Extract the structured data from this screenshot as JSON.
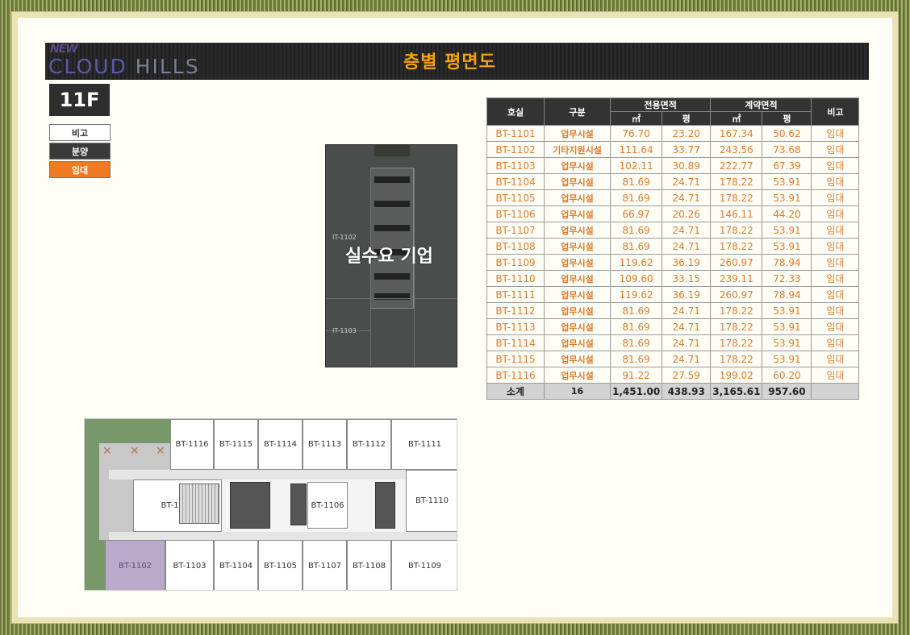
{
  "header": {
    "logo_new": "NEW",
    "logo_cloud": "CLOUD",
    "logo_hills": " HILLS",
    "title": "층별 평면도"
  },
  "floor": "11F",
  "legend": [
    {
      "label": "비고"
    },
    {
      "label": "분양"
    },
    {
      "label": "임대"
    }
  ],
  "small_plan": {
    "label_top": "IT-1102",
    "label_bottom": "IT-1103",
    "overlay": "실수요 기업"
  },
  "table": {
    "headers": {
      "unit": "호실",
      "type": "구분",
      "exclusive": "전용면적",
      "contract": "계약면적",
      "sqm1": "㎡",
      "py1": "평",
      "sqm2": "㎡",
      "py2": "평",
      "note": "비고"
    },
    "rows": [
      [
        "BT-1101",
        "업무시설",
        "76.70",
        "23.20",
        "167.34",
        "50.62",
        "임대"
      ],
      [
        "BT-1102",
        "기타지원시설",
        "111.64",
        "33.77",
        "243.56",
        "73.68",
        "임대"
      ],
      [
        "BT-1103",
        "업무시설",
        "102.11",
        "30.89",
        "222.77",
        "67.39",
        "임대"
      ],
      [
        "BT-1104",
        "업무시설",
        "81.69",
        "24.71",
        "178.22",
        "53.91",
        "임대"
      ],
      [
        "BT-1105",
        "업무시설",
        "81.69",
        "24.71",
        "178.22",
        "53.91",
        "임대"
      ],
      [
        "BT-1106",
        "업무시설",
        "66.97",
        "20.26",
        "146.11",
        "44.20",
        "임대"
      ],
      [
        "BT-1107",
        "업무시설",
        "81.69",
        "24.71",
        "178.22",
        "53.91",
        "임대"
      ],
      [
        "BT-1108",
        "업무시설",
        "81.69",
        "24.71",
        "178.22",
        "53.91",
        "임대"
      ],
      [
        "BT-1109",
        "업무시설",
        "119.62",
        "36.19",
        "260.97",
        "78.94",
        "임대"
      ],
      [
        "BT-1110",
        "업무시설",
        "109.60",
        "33.15",
        "239.11",
        "72.33",
        "임대"
      ],
      [
        "BT-1111",
        "업무시설",
        "119.62",
        "36.19",
        "260.97",
        "78.94",
        "임대"
      ],
      [
        "BT-1112",
        "업무시설",
        "81.69",
        "24.71",
        "178.22",
        "53.91",
        "임대"
      ],
      [
        "BT-1113",
        "업무시설",
        "81.69",
        "24.71",
        "178.22",
        "53.91",
        "임대"
      ],
      [
        "BT-1114",
        "업무시설",
        "81.69",
        "24.71",
        "178.22",
        "53.91",
        "임대"
      ],
      [
        "BT-1115",
        "업무시설",
        "81.69",
        "24.71",
        "178.22",
        "53.91",
        "임대"
      ],
      [
        "BT-1116",
        "업무시설",
        "91.22",
        "27.59",
        "199.02",
        "60.20",
        "임대"
      ]
    ],
    "total": [
      "소계",
      "16",
      "1,451.00",
      "438.93",
      "3,165.61",
      "957.60",
      ""
    ]
  },
  "big_plan": {
    "top_rooms": [
      "BT-1116",
      "BT-1115",
      "BT-1114",
      "BT-1113",
      "BT-1112",
      "BT-1111"
    ],
    "mid_rooms": [
      "BT-1101",
      "BT-1106",
      "BT-1110"
    ],
    "bottom_rooms": [
      "BT-1102",
      "BT-1103",
      "BT-1104",
      "BT-1105",
      "BT-1107",
      "BT-1108",
      "BT-1109"
    ]
  },
  "colors": {
    "header_title": "#f2a20c",
    "rent": "#ee7a23",
    "table_text": "#e37a29",
    "purple_unit": "#b9aacb"
  }
}
